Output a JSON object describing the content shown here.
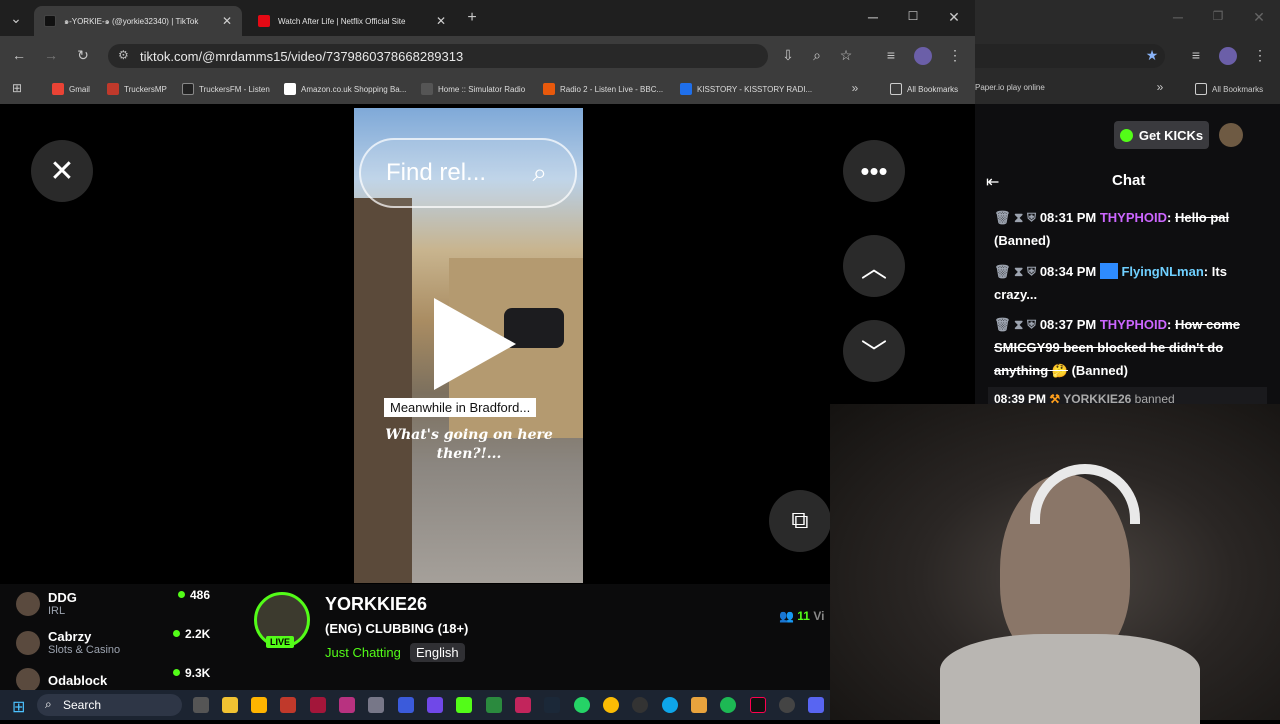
{
  "browser": {
    "tabs": [
      {
        "title": "๑-YORKIE-๑ (@yorkie32340) | TikTok",
        "color": "#111111"
      },
      {
        "title": "Watch After Life | Netflix Official Site",
        "color": "#e50914"
      }
    ],
    "url": "tiktok.com/@mrdamms15/video/7379860378668289313",
    "bookmarks": [
      {
        "label": "Gmail",
        "color": "#ea4335"
      },
      {
        "label": "TruckersMP",
        "color": "#c0392b"
      },
      {
        "label": "TruckersFM - Listen",
        "color": "#222222"
      },
      {
        "label": "Amazon.co.uk Shopping Ba...",
        "color": "#ffffff"
      },
      {
        "label": "Home :: Simulator Radio",
        "color": "#555555"
      },
      {
        "label": "Radio 2 - Listen Live - BBC...",
        "color": "#e8590c"
      },
      {
        "label": "KISSTORY - KISSTORY RADI...",
        "color": "#1f6feb"
      }
    ],
    "all_bookmarks": "All Bookmarks",
    "right_bookmark": "Paper.io play online",
    "right_all_bookmarks": "All Bookmarks"
  },
  "video": {
    "search_placeholder": "Find rel...",
    "caption1": "Meanwhile in Bradford...",
    "caption2": "What's going on here then?!..."
  },
  "kick": {
    "get_kicks": "Get KICKs",
    "chat_title": "Chat",
    "messages": [
      {
        "time": "08:31 PM",
        "user": "THYPHOID",
        "user_color": "#cc66ff",
        "text": "Hello pal",
        "status": "(Banned)",
        "struck": true
      },
      {
        "time": "08:34 PM",
        "user": "FlyingNLman",
        "user_color": "#6fd0ff",
        "text": "Its crazy...",
        "status": "",
        "struck": false
      },
      {
        "time": "08:37 PM",
        "user": "THYPHOID",
        "user_color": "#cc66ff",
        "text": "How come SMICGY99 been blocked he didn't do anything 🤔",
        "status": "(Banned)",
        "struck": true
      }
    ],
    "ban_notice": {
      "time": "08:39 PM",
      "user": "YORKKIE26",
      "text": "banned"
    },
    "streamer": {
      "name": "YORKKIE26",
      "title": "(ENG) CLUBBING (18+)",
      "category": "Just Chatting",
      "language": "English",
      "live": "LIVE",
      "viewers": "11",
      "viewers_label": "Vi"
    },
    "following": [
      {
        "name": "DDG",
        "sub": "IRL",
        "count": "486"
      },
      {
        "name": "Cabrzy",
        "sub": "Slots & Casino",
        "count": "2.2K"
      },
      {
        "name": "Odablock",
        "sub": "",
        "count": "9.3K"
      }
    ]
  },
  "taskbar": {
    "search": "Search"
  },
  "colors": {
    "kick_green": "#53fc18",
    "chrome_bg": "#3c3c3c",
    "tab_bg": "#1f1f1f"
  }
}
